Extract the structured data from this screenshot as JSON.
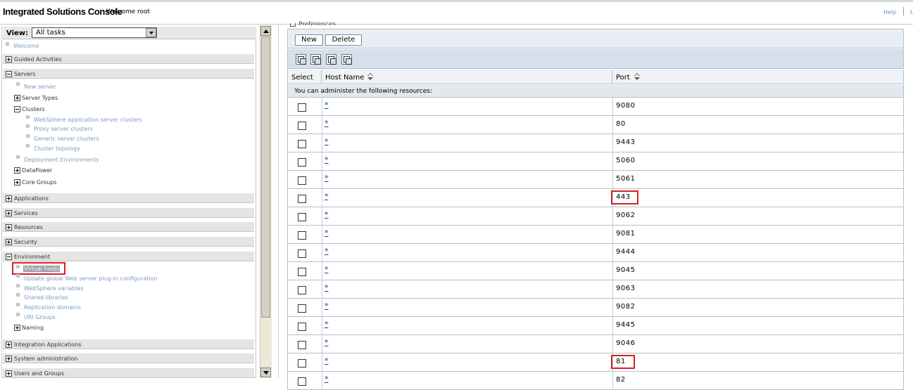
{
  "header": {
    "title": "Integrated Solutions Console",
    "welcome": "Welcome root",
    "help": "Help",
    "logout": "L"
  },
  "nav": {
    "view_label": "View:",
    "view_value": "All tasks",
    "welcome": "Welcome",
    "guided": "Guided Activities",
    "servers": "Servers",
    "new_server": "New server",
    "server_types": "Server Types",
    "clusters": "Clusters",
    "was_clusters": "WebSphere application server clusters",
    "proxy_clusters": "Proxy server clusters",
    "generic_clusters": "Generic server clusters",
    "cluster_topology": "Cluster topology",
    "deployment_env": "Deployment Environments",
    "datapower": "DataPower",
    "core_groups": "Core Groups",
    "applications": "Applications",
    "services": "Services",
    "resources": "Resources",
    "security": "Security",
    "environment": "Environment",
    "virtual_hosts": "Virtual hosts",
    "update_plugin": "Update global Web server plug-in configuration",
    "ws_variables": "WebSphere variables",
    "shared_libs": "Shared libraries",
    "replication": "Replication domains",
    "uri_groups": "URI Groups",
    "naming": "Naming",
    "integration_apps": "Integration Applications",
    "system_admin": "System administration",
    "users_groups": "Users and Groups"
  },
  "main": {
    "preferences": "Preferences",
    "new_btn": "New",
    "delete_btn": "Delete",
    "col_select": "Select",
    "col_host": "Host Name",
    "col_port": "Port",
    "resources_text": "You can administer the following resources:",
    "rows": [
      {
        "host": "*",
        "port": "9080"
      },
      {
        "host": "*",
        "port": "80"
      },
      {
        "host": "*",
        "port": "9443"
      },
      {
        "host": "*",
        "port": "5060"
      },
      {
        "host": "*",
        "port": "5061"
      },
      {
        "host": "*",
        "port": "443"
      },
      {
        "host": "*",
        "port": "9062"
      },
      {
        "host": "*",
        "port": "9081"
      },
      {
        "host": "*",
        "port": "9444"
      },
      {
        "host": "*",
        "port": "9045"
      },
      {
        "host": "*",
        "port": "9063"
      },
      {
        "host": "*",
        "port": "9082"
      },
      {
        "host": "*",
        "port": "9445"
      },
      {
        "host": "*",
        "port": "9046"
      },
      {
        "host": "*",
        "port": "81"
      },
      {
        "host": "*",
        "port": "82"
      }
    ]
  },
  "colors": {
    "highlight": "#d52020",
    "link": "#2040a0",
    "nav_link": "#7d9bc0"
  }
}
